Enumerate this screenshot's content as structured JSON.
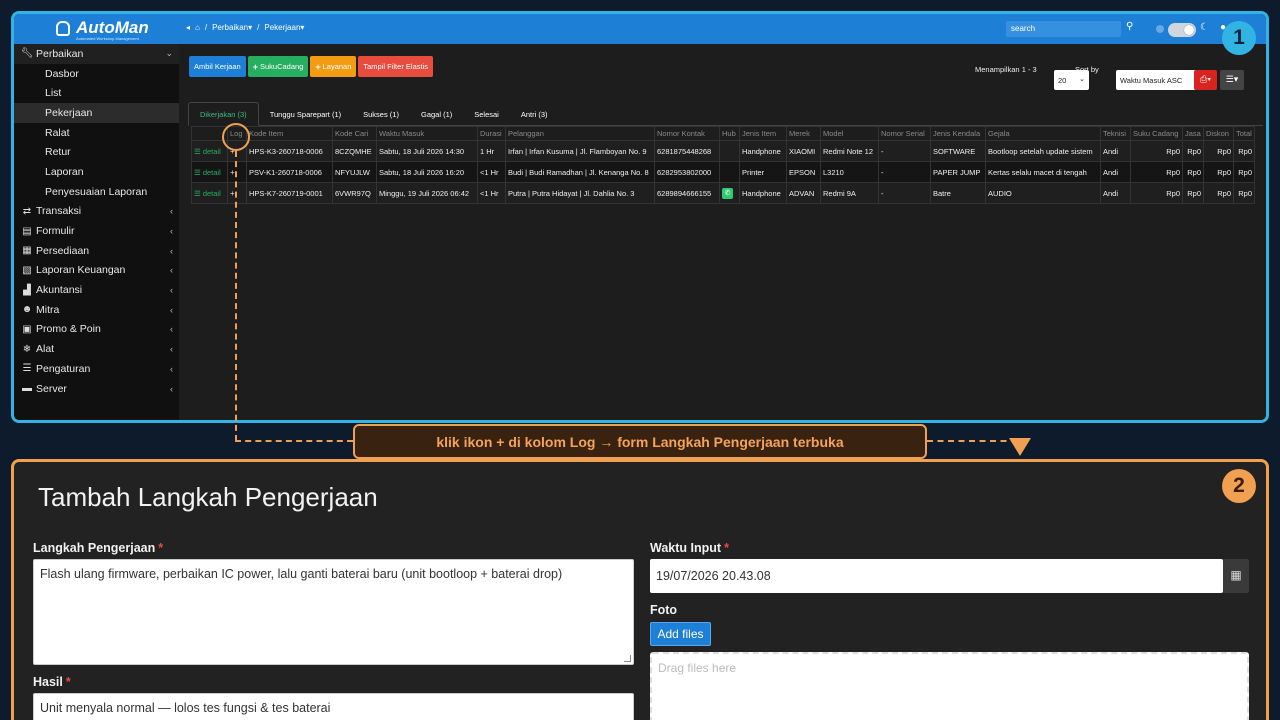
{
  "panel1_badge": "1",
  "panel2_badge": "2",
  "brand": {
    "name": "AutoMan",
    "tagline": "Automated Workshop Management"
  },
  "breadcrumb": {
    "items": [
      "Perbaikan",
      "Pekerjaan"
    ]
  },
  "topbar": {
    "search_placeholder": "search"
  },
  "sidebar": {
    "items": [
      {
        "label": "Perbaikan",
        "icon": "wrench-icon",
        "type": "head",
        "expanded": true
      },
      {
        "label": "Dasbor",
        "type": "sub"
      },
      {
        "label": "List",
        "type": "sub"
      },
      {
        "label": "Pekerjaan",
        "type": "sub",
        "active": true
      },
      {
        "label": "Ralat",
        "type": "sub"
      },
      {
        "label": "Retur",
        "type": "sub"
      },
      {
        "label": "Laporan",
        "type": "sub"
      },
      {
        "label": "Penyesuaian Laporan",
        "type": "sub"
      },
      {
        "label": "Transaksi",
        "icon": "exchange-icon",
        "type": "group"
      },
      {
        "label": "Formulir",
        "icon": "form-icon",
        "type": "group"
      },
      {
        "label": "Persediaan",
        "icon": "grid-icon",
        "type": "group"
      },
      {
        "label": "Laporan Keuangan",
        "icon": "report-icon",
        "type": "group"
      },
      {
        "label": "Akuntansi",
        "icon": "chart-icon",
        "type": "group"
      },
      {
        "label": "Mitra",
        "icon": "users-icon",
        "type": "group"
      },
      {
        "label": "Promo & Poin",
        "icon": "gift-icon",
        "type": "group"
      },
      {
        "label": "Alat",
        "icon": "snowflake-icon",
        "type": "group"
      },
      {
        "label": "Pengaturan",
        "icon": "sliders-icon",
        "type": "group"
      },
      {
        "label": "Server",
        "icon": "server-icon",
        "type": "group"
      }
    ]
  },
  "toolbar": {
    "ambil_label": "Ambil Kerjaan",
    "sukucadang_label": "SukuCadang",
    "layanan_label": "Layanan",
    "filter_label": "Tampil Filter Elastis",
    "showing_label": "Menampilkan 1 - 3",
    "page_size": "20",
    "sort_label": "Sort by",
    "sort_value": "Waktu Masuk ASC"
  },
  "tabs": [
    "Dikerjakan (3)",
    "Tunggu Sparepart (1)",
    "Sukses (1)",
    "Gagal (1)",
    "Selesai",
    "Antri (3)"
  ],
  "table": {
    "headers": [
      "",
      "Log",
      "Kode Item",
      "Kode Cari",
      "Waktu Masuk",
      "Durasi",
      "Pelanggan",
      "Nomor Kontak",
      "Hub",
      "Jenis Item",
      "Merek",
      "Model",
      "Nomor Serial",
      "Jenis Kendala",
      "Gejala",
      "Teknisi",
      "Suku Cadang",
      "Jasa",
      "Diskon",
      "Total"
    ],
    "detail_label": "detail",
    "rows": [
      {
        "kode_item": "HPS-K3-260718-0006",
        "kode_cari": "8CZQMHE",
        "waktu": "Sabtu, 18 Juli 2026 14:30",
        "durasi": "1 Hr",
        "pelanggan": "Irfan | Irfan Kusuma | Jl. Flamboyan No. 9",
        "kontak": "6281875448268",
        "hub": "",
        "jenis": "Handphone",
        "merek": "XIAOMI",
        "model": "Redmi Note 12",
        "serial": "-",
        "kendala": "SOFTWARE",
        "gejala": "Bootloop setelah update sistem",
        "teknisi": "Andi",
        "suku": "Rp0",
        "jasa": "Rp0",
        "diskon": "Rp0",
        "total": "Rp0"
      },
      {
        "kode_item": "PSV-K1-260718-0006",
        "kode_cari": "NFYUJLW",
        "waktu": "Sabtu, 18 Juli 2026 16:20",
        "durasi": "<1 Hr",
        "pelanggan": "Budi | Budi Ramadhan | Jl. Kenanga No. 8",
        "kontak": "6282953802000",
        "hub": "",
        "jenis": "Printer",
        "merek": "EPSON",
        "model": "L3210",
        "serial": "-",
        "kendala": "PAPER JUMP",
        "gejala": "Kertas selalu macet di tengah",
        "teknisi": "Andi",
        "suku": "Rp0",
        "jasa": "Rp0",
        "diskon": "Rp0",
        "total": "Rp0"
      },
      {
        "kode_item": "HPS-K7-260719-0001",
        "kode_cari": "6VWR97Q",
        "waktu": "Minggu, 19 Juli 2026 06:42",
        "durasi": "<1 Hr",
        "pelanggan": "Putra | Putra Hidayat | Jl. Dahlia No. 3",
        "kontak": "6289894666155",
        "hub": "whatsapp",
        "jenis": "Handphone",
        "merek": "ADVAN",
        "model": "Redmi 9A",
        "serial": "-",
        "kendala": "Batre",
        "gejala": "AUDIO",
        "teknisi": "Andi",
        "suku": "Rp0",
        "jasa": "Rp0",
        "diskon": "Rp0",
        "total": "Rp0"
      }
    ]
  },
  "callout": "klik ikon + di kolom Log → form Langkah Pengerjaan terbuka",
  "form": {
    "title": "Tambah Langkah Pengerjaan",
    "langkah_label": "Langkah Pengerjaan",
    "langkah_value": "Flash ulang firmware, perbaikan IC power, lalu ganti baterai baru (unit bootloop + baterai drop)",
    "hasil_label": "Hasil",
    "hasil_value": "Unit menyala normal — lolos tes fungsi & tes baterai",
    "waktu_label": "Waktu Input",
    "waktu_value": "19/07/2026 20.43.08",
    "foto_label": "Foto",
    "add_files_label": "Add files",
    "drop_placeholder": "Drag files here",
    "required_mark": "*"
  },
  "colors": {
    "accent_panel1": "#31b4e3",
    "accent_panel2": "#f0a050",
    "primary": "#1e7fd6"
  }
}
